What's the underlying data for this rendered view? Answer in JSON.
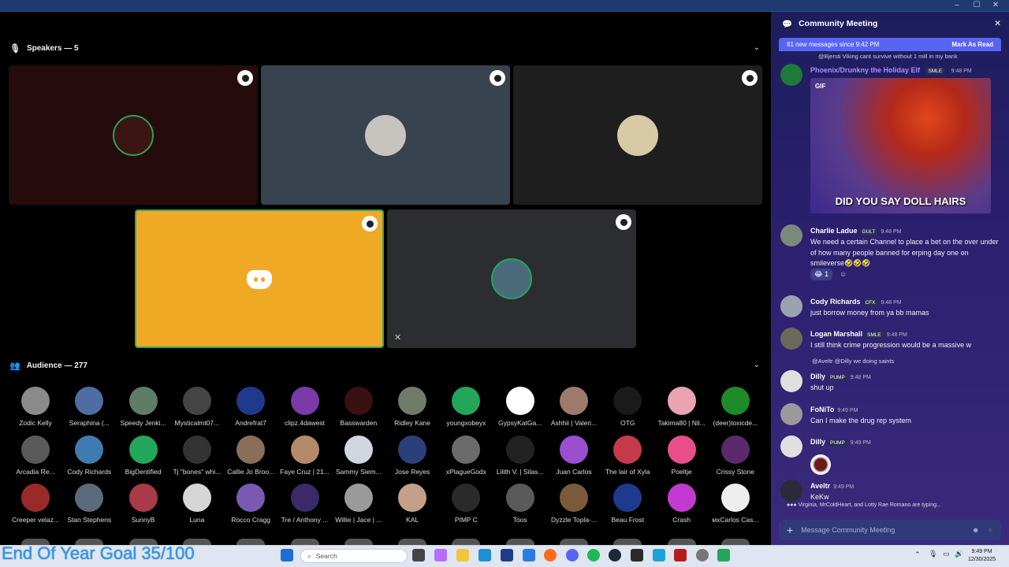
{
  "window": {
    "controls": [
      "–",
      "☐",
      "✕"
    ]
  },
  "speakers": {
    "title": "Speakers — 5",
    "tiles": [
      {
        "bg": "#260b0c",
        "avatar": "#3b1414"
      },
      {
        "bg": "#38434f",
        "avatar": "#c7c4c0"
      },
      {
        "bg": "#1e1e1e",
        "avatar": "#d8c9a6"
      },
      {
        "bg": "#f0a924",
        "avatar": "discord"
      },
      {
        "bg": "#2b2d31",
        "avatar": "#4b6b7a"
      }
    ]
  },
  "audience": {
    "title": "Audience — 277",
    "members": [
      {
        "name": "Zodic Kelly",
        "c": "#8a8a8a"
      },
      {
        "name": "Seraphina (...",
        "c": "#4e6ea3"
      },
      {
        "name": "Speedy Jenki...",
        "c": "#5f7c66"
      },
      {
        "name": "Mysticalmt07...",
        "c": "#444"
      },
      {
        "name": "Andrefrat7",
        "c": "#1f3a8c"
      },
      {
        "name": "clipz.4dawest",
        "c": "#7a3ba8"
      },
      {
        "name": "Basswarden",
        "c": "#3a1010"
      },
      {
        "name": "Ridley Kane",
        "c": "#6f7a6a"
      },
      {
        "name": "youngxobeyx",
        "c": "#23a55a"
      },
      {
        "name": "GypsyKatGa...",
        "c": "#ffffff"
      },
      {
        "name": "Ashhii | Valeri...",
        "c": "#9c7b6b"
      },
      {
        "name": "OTG",
        "c": "#1a1a1a"
      },
      {
        "name": "Takima80 | Nil...",
        "c": "#e9a3b3"
      },
      {
        "name": "(deer)toxicde...",
        "c": "#1e8a2a"
      },
      {
        "name": "Arcadia Re...",
        "c": "#5a5a5a"
      },
      {
        "name": "Cody Richards",
        "c": "#3f7bb0"
      },
      {
        "name": "BigDentified",
        "c": "#23a55a"
      },
      {
        "name": "Tj \"bones\" whi...",
        "c": "#333"
      },
      {
        "name": "Callie Jo Broo...",
        "c": "#8a6e5a"
      },
      {
        "name": "Faye Cruz | 21...",
        "c": "#b58a6a"
      },
      {
        "name": "Sammy Siem...",
        "c": "#cfd6dd"
      },
      {
        "name": "Jose Reyes",
        "c": "#2b3f7a"
      },
      {
        "name": "xPlagueGodx",
        "c": "#6b6b6b"
      },
      {
        "name": "Lilith V. | Silas...",
        "c": "#222"
      },
      {
        "name": "Juan Carlos",
        "c": "#9a4fd1"
      },
      {
        "name": "The lair of Xyla",
        "c": "#c43a4a"
      },
      {
        "name": "Poeltje",
        "c": "#e84f8a"
      },
      {
        "name": "Crissy Stone",
        "c": "#5a2a6a"
      },
      {
        "name": "Creeper velaz...",
        "c": "#9a2a2a"
      },
      {
        "name": "Stan Stephens",
        "c": "#5a6a7a"
      },
      {
        "name": "SunnyB",
        "c": "#a83a4a"
      },
      {
        "name": "Luna",
        "c": "#d6d6d6"
      },
      {
        "name": "Rocco Cragg",
        "c": "#7a5ab0"
      },
      {
        "name": "Tre / Anthony ...",
        "c": "#3a2a6a"
      },
      {
        "name": "Willie | Jace | ...",
        "c": "#9a9a9a"
      },
      {
        "name": "KAL",
        "c": "#c4a08a"
      },
      {
        "name": "PIMP C",
        "c": "#2a2a2a"
      },
      {
        "name": "Toos",
        "c": "#5a5a5a"
      },
      {
        "name": "Dyzzle Topla-...",
        "c": "#7a5a3a"
      },
      {
        "name": "Beau Frost",
        "c": "#1f3a8c"
      },
      {
        "name": "Crash",
        "c": "#c43ad1"
      },
      {
        "name": "мxCarlos Cas...",
        "c": "#eeeeee"
      }
    ]
  },
  "chat": {
    "title": "Community Meeting",
    "new_messages": "81 new messages since 9:42 PM",
    "mark_read": "Mark As Read",
    "reply_top": "@Bjersti Viking cant survive without 1 mill in my bank",
    "gif_author": "Phoenix/Drunkny the Holiday Elf",
    "gif_tag": "SMLE",
    "gif_time": "9:48 PM",
    "gif_label": "GIF",
    "gif_caption": "DID YOU SAY DOLL HAIRS",
    "messages": [
      {
        "name": "Charlie Ladue",
        "tag": "GULT",
        "time": "9:48 PM",
        "text": "We need a certain Channel to place a bet on the over under of how many people banned for erping day one on smileverse🤣🤣🤣",
        "c": "#7a8a7a"
      },
      {
        "name": "Cody Richards",
        "tag": "CFX",
        "time": "9:48 PM",
        "text": "just borrow money from ya bb mamas",
        "c": "#9aa4b0"
      },
      {
        "name": "Logan Marshall",
        "tag": "SMLE",
        "time": "9:48 PM",
        "text": "I still think crime progression would be a massive w",
        "c": "#6a6a5a"
      },
      {
        "name": "Dilly",
        "tag": "PUMP",
        "time": "9:48 PM",
        "text": "shut up",
        "c": "#e0e0e0"
      },
      {
        "name": "FoNiTo",
        "tag": "",
        "time": "9:49 PM",
        "text": "Can I make the drug rep system",
        "c": "#9a9a9a"
      },
      {
        "name": "Dilly",
        "tag": "PUMP",
        "time": "9:49 PM",
        "text": "",
        "c": "#e0e0e0"
      },
      {
        "name": "Aveltr",
        "tag": "",
        "time": "9:49 PM",
        "text": "KeKw",
        "c": "#2a2a3a"
      }
    ],
    "reaction": "😂 1",
    "reply_dilly": "@Aveltr @Dilly we doing saints",
    "typing": "Virginia, MrColdHeart, and Lotty Rae Romano are typing...",
    "composer": "Message Community Meeting"
  },
  "taskbar": {
    "goal": "End Of Year Goal 35/100",
    "search": "Search",
    "time": "9:49 PM",
    "date": "12/30/2025"
  }
}
